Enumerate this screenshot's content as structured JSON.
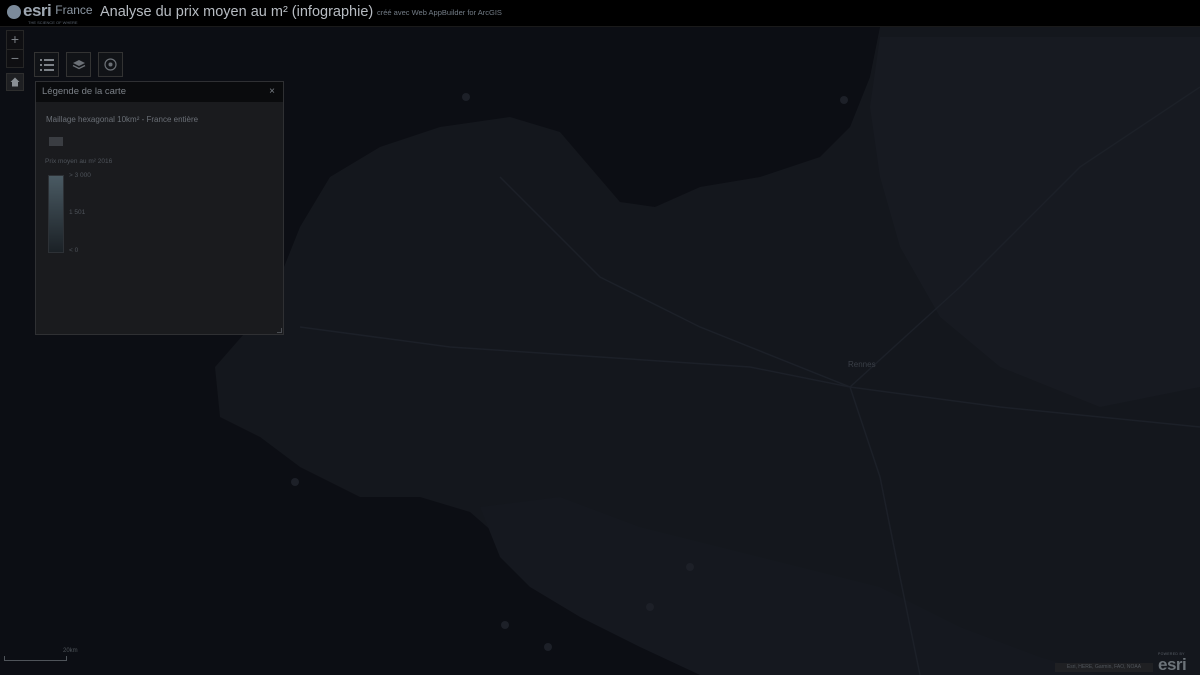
{
  "header": {
    "logo_word": "esri",
    "logo_country": "France",
    "logo_tagline": "THE SCIENCE OF WHERE",
    "title": "Analyse du prix moyen au m² (infographie)",
    "subtitle": "créé avec Web AppBuilder for ArcGIS"
  },
  "map_controls": {
    "zoom_in": "+",
    "zoom_out": "−"
  },
  "legend": {
    "title": "Légende de la carte",
    "close": "×",
    "layer_name": "Maillage hexagonal 10km² - France entière",
    "field_name": "Prix moyen au m² 2016",
    "ramp_max": "> 3 000",
    "ramp_mid": "1 501",
    "ramp_min": "< 0"
  },
  "map": {
    "background_color": "#0c0e14",
    "land_color": "#14171d",
    "place_label": "Rennes"
  },
  "scale_bar": {
    "label": "20km"
  },
  "footer": {
    "attribution": "Esri, HERE, Garmin, FAO, NOAA",
    "powered_by": "POWERED BY",
    "esri_word": "esri"
  }
}
